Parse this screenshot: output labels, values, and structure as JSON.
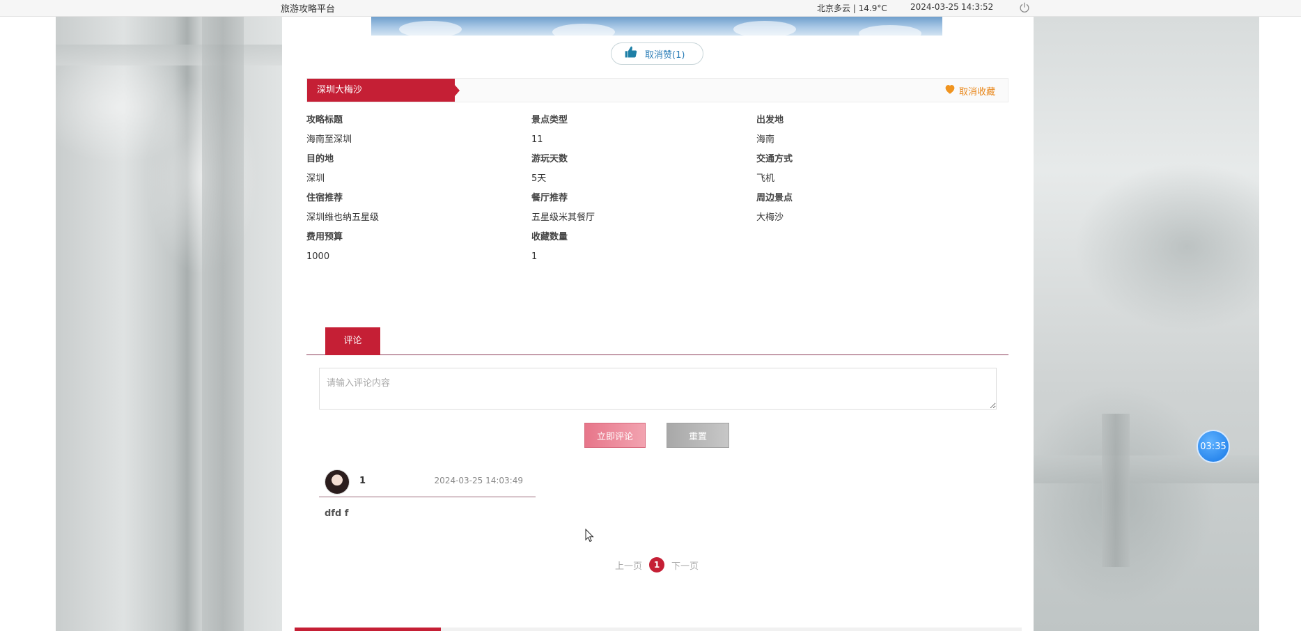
{
  "topbar": {
    "site_title": "旅游攻略平台",
    "weather": "北京多云 | 14.9°C",
    "date": "2024-03-25",
    "time": "14:3:52",
    "power_icon": "power-icon"
  },
  "like": {
    "label": "取消赞(1)",
    "icon": "thumbs-up-icon"
  },
  "strategy": {
    "title": "深圳大梅沙",
    "favorite_label": "取消收藏",
    "favorite_icon": "heart-icon"
  },
  "details": {
    "rows": [
      [
        {
          "label": "攻略标题",
          "value": "海南至深圳"
        },
        {
          "label": "景点类型",
          "value": "11"
        },
        {
          "label": "出发地",
          "value": "海南"
        }
      ],
      [
        {
          "label": "目的地",
          "value": "深圳"
        },
        {
          "label": "游玩天数",
          "value": "5天"
        },
        {
          "label": "交通方式",
          "value": "飞机"
        }
      ],
      [
        {
          "label": "住宿推荐",
          "value": "深圳维也纳五星级"
        },
        {
          "label": "餐厅推荐",
          "value": "五星级米其餐厅"
        },
        {
          "label": "周边景点",
          "value": "大梅沙"
        }
      ],
      [
        {
          "label": "费用预算",
          "value": "1000"
        },
        {
          "label": "收藏数量",
          "value": "1"
        }
      ]
    ]
  },
  "comments_section": {
    "tab_label": "评论",
    "input_placeholder": "请输入评论内容",
    "submit_label": "立即评论",
    "reset_label": "重置",
    "items": [
      {
        "user": "1",
        "time": "2024-03-25 14:03:49",
        "content": "dfd f"
      }
    ]
  },
  "pager": {
    "prev_label": "上一页",
    "current_page": "1",
    "next_label": "下一页"
  },
  "timer": {
    "label": "03:35"
  },
  "colors": {
    "accent": "#c51f35",
    "favorite": "#e98a20",
    "like_text": "#2e7fb8",
    "timer": "#1677e6"
  }
}
